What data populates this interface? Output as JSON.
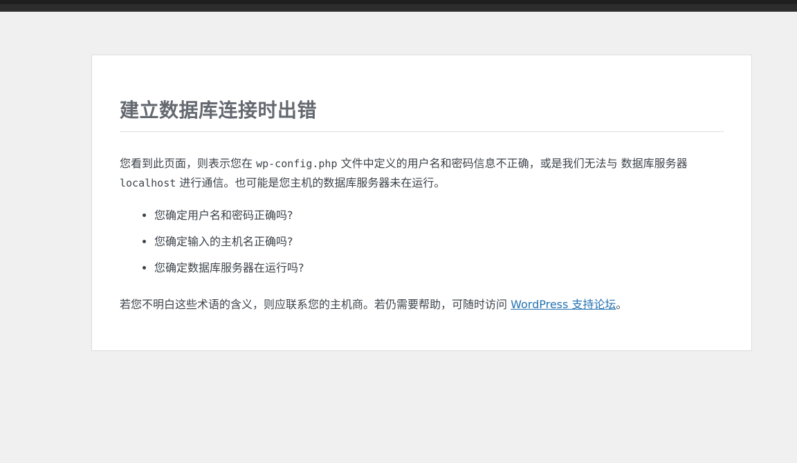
{
  "error": {
    "title": "建立数据库连接时出错",
    "desc_part1": "您看到此页面，则表示您在 ",
    "config_file": "wp-config.php",
    "desc_part2": " 文件中定义的用户名和密码信息不正确，或是我们无法与 数据库服务器 ",
    "host": "localhost",
    "desc_part3": " 进行通信。也可能是您主机的数据库服务器未在运行。",
    "checklist": [
      "您确定用户名和密码正确吗?",
      "您确定输入的主机名正确吗?",
      "您确定数据库服务器在运行吗?"
    ],
    "footer_part1": "若您不明白这些术语的含义，则应联系您的主机商。若仍需要帮助，可随时访问 ",
    "footer_link": "WordPress 支持论坛",
    "footer_part2": "。"
  }
}
